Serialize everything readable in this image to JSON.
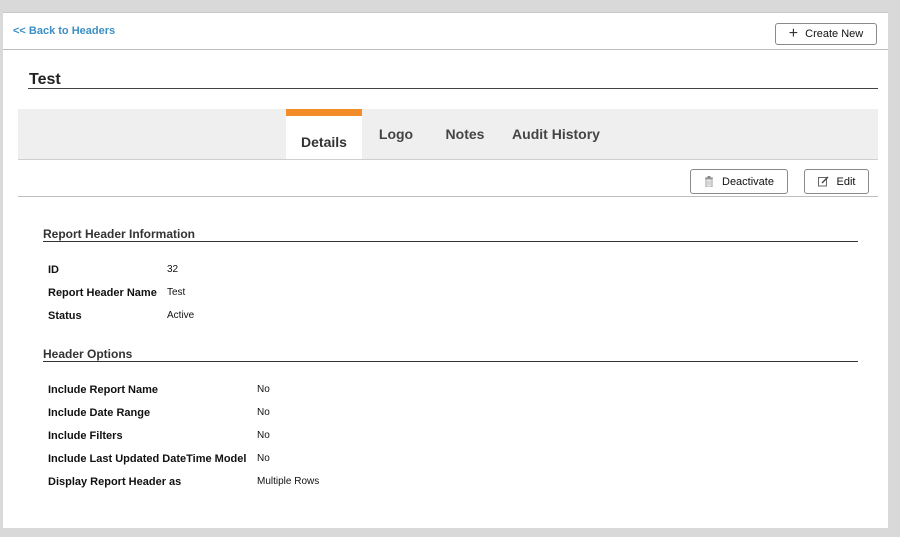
{
  "nav": {
    "back_label": "<< Back to Headers"
  },
  "toolbar": {
    "create_label": "Create New"
  },
  "page": {
    "title": "Test"
  },
  "tabs": [
    {
      "label": "Details",
      "active": true
    },
    {
      "label": "Logo",
      "active": false
    },
    {
      "label": "Notes",
      "active": false
    },
    {
      "label": "Audit History",
      "active": false
    }
  ],
  "actions": {
    "deactivate_label": "Deactivate",
    "edit_label": "Edit"
  },
  "report_header_info": {
    "title": "Report Header Information",
    "rows": [
      {
        "label": "ID",
        "value": "32"
      },
      {
        "label": "Report Header Name",
        "value": "Test"
      },
      {
        "label": "Status",
        "value": "Active"
      }
    ]
  },
  "header_options": {
    "title": "Header Options",
    "rows": [
      {
        "label": "Include Report Name",
        "value": "No"
      },
      {
        "label": "Include Date Range",
        "value": "No"
      },
      {
        "label": "Include Filters",
        "value": "No"
      },
      {
        "label": "Include Last Updated DateTime Model",
        "value": "No"
      },
      {
        "label": "Display Report Header as",
        "value": "Multiple Rows"
      }
    ]
  },
  "colors": {
    "accent": "#f28c28",
    "link": "#3b8fc4"
  }
}
